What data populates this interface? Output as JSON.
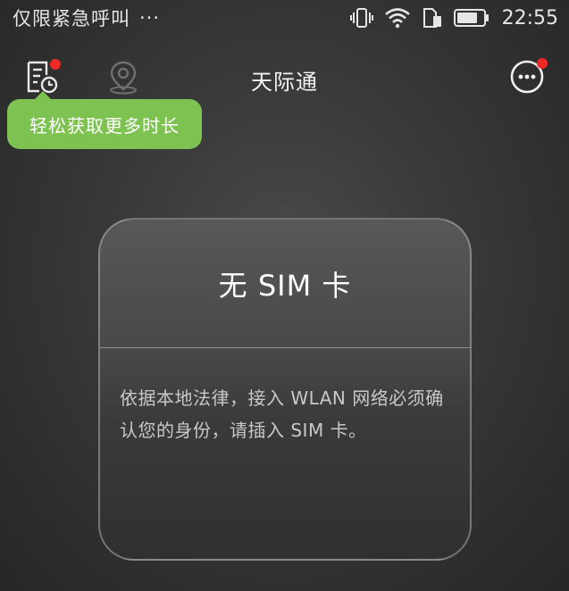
{
  "status_bar": {
    "carrier": "仅限紧急呼叫",
    "overflow": "···",
    "time": "22:55",
    "icons": [
      "vibrate-icon",
      "wifi-icon",
      "sim-icon",
      "battery-icon"
    ]
  },
  "app": {
    "title": "天际通",
    "tooltip": "轻松获取更多时长",
    "badge_color": "#ee2a26",
    "tooltip_color": "#7ec252",
    "icons": [
      "records-icon",
      "location-icon",
      "more-icon"
    ]
  },
  "sim_card": {
    "title": "无 SIM 卡",
    "message": "依据本地法律，接入 WLAN 网络必须确认您的身份，请插入 SIM 卡。"
  }
}
